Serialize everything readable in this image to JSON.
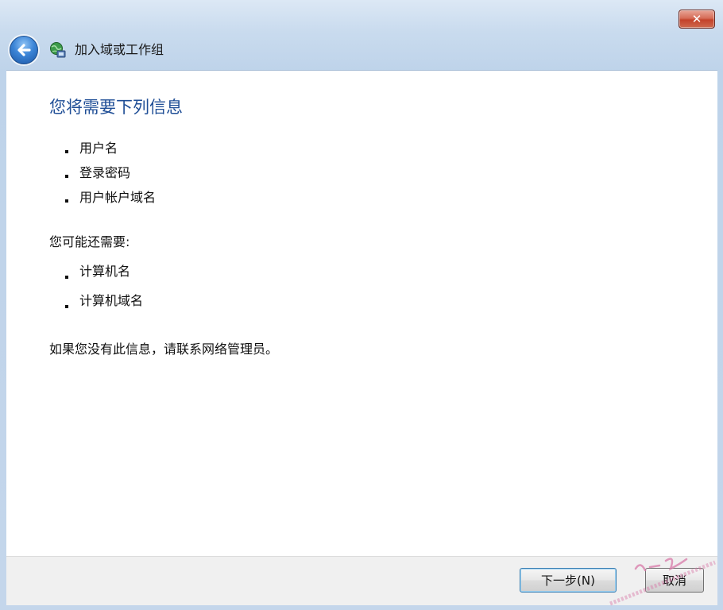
{
  "window": {
    "title": "加入域或工作组",
    "close_glyph": "✕"
  },
  "content": {
    "heading": "您将需要下列信息",
    "required_items": [
      "用户名",
      "登录密码",
      "用户帐户域名"
    ],
    "optional_intro": "您可能还需要:",
    "optional_items": [
      "计算机名",
      "计算机域名"
    ],
    "note": "如果您没有此信息，请联系网络管理员。"
  },
  "buttons": {
    "next": "下一步(N)",
    "cancel": "取消"
  },
  "icons": {
    "back": "back-arrow-icon",
    "app": "network-globe-icon",
    "close": "close-icon"
  },
  "colors": {
    "heading": "#1f4e96",
    "close_button": "#c3432b",
    "back_button": "#2f74c9"
  }
}
